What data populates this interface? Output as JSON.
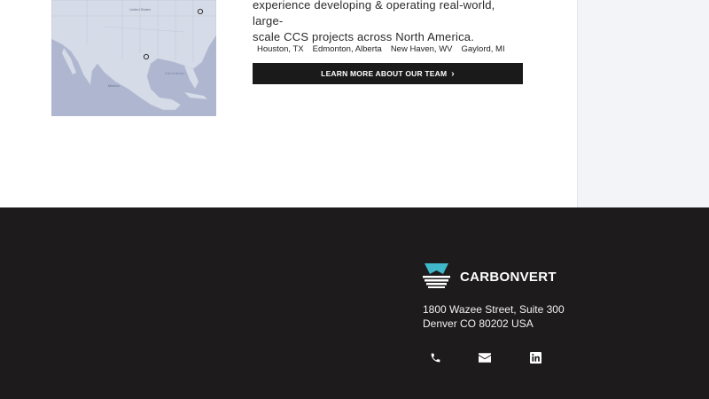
{
  "map": {
    "labels": {
      "united_states": "United States",
      "mexico": "Mexico",
      "gulf": "Gulf of Mexico"
    }
  },
  "intro": {
    "line1": "experience developing & operating real-world, large-",
    "line2": "scale CCS projects across North America."
  },
  "locations": [
    "Houston, TX",
    "Edmonton, Alberta",
    "New Haven, WV",
    "Gaylord, MI"
  ],
  "team_button": {
    "label": "LEARN MORE ABOUT OUR TEAM",
    "icon": "chevron-right-icon"
  },
  "footer": {
    "brand": "CARBONVERT",
    "address_line1": "1800 Wazee Street, Suite 300",
    "address_line2": "Denver CO 80202 USA",
    "social": [
      "phone-icon",
      "email-icon",
      "linkedin-icon"
    ],
    "colors": {
      "background": "#1d1b1c",
      "logo_accent": "#3fb8c9"
    }
  }
}
